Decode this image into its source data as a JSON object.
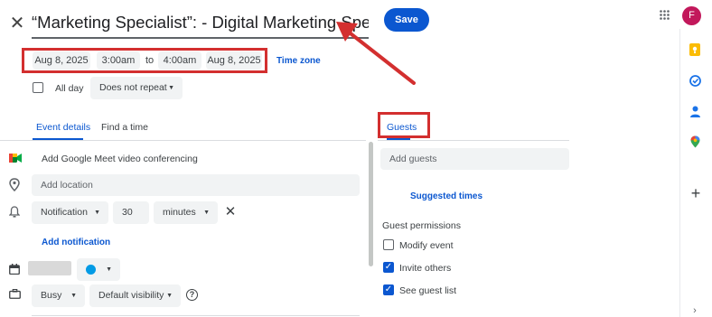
{
  "header": {
    "close_icon": "close-icon",
    "title": "“Marketing Specialist”:  - Digital Marketing Specialist and",
    "save_label": "Save"
  },
  "datetime": {
    "start_date": "Aug 8, 2025",
    "start_time": "3:00am",
    "to_label": "to",
    "end_time": "4:00am",
    "end_date": "Aug 8, 2025",
    "time_zone": "Time zone"
  },
  "options": {
    "all_day_label": "All day",
    "all_day_checked": false,
    "repeat_value": "Does not repeat"
  },
  "tabs": {
    "event_details": "Event details",
    "find_a_time": "Find a time",
    "guests": "Guests"
  },
  "details": {
    "meet": "Add Google Meet video conferencing",
    "location_placeholder": "Add location",
    "notification_type": "Notification",
    "notification_amount": "30",
    "notification_unit": "minutes",
    "add_notification": "Add notification",
    "busy_value": "Busy",
    "visibility_value": "Default visibility"
  },
  "guests": {
    "add_placeholder": "Add guests",
    "suggested_times": "Suggested times",
    "permissions_title": "Guest permissions",
    "permissions": [
      {
        "label": "Modify event",
        "checked": false
      },
      {
        "label": "Invite others",
        "checked": true
      },
      {
        "label": "See guest list",
        "checked": true
      }
    ]
  },
  "account": {
    "avatar_letter": "F"
  },
  "colors": {
    "accent": "#0b57d0",
    "annotation_red": "#d32f2f",
    "event_color": "#039be5",
    "avatar": "#c2185b"
  }
}
